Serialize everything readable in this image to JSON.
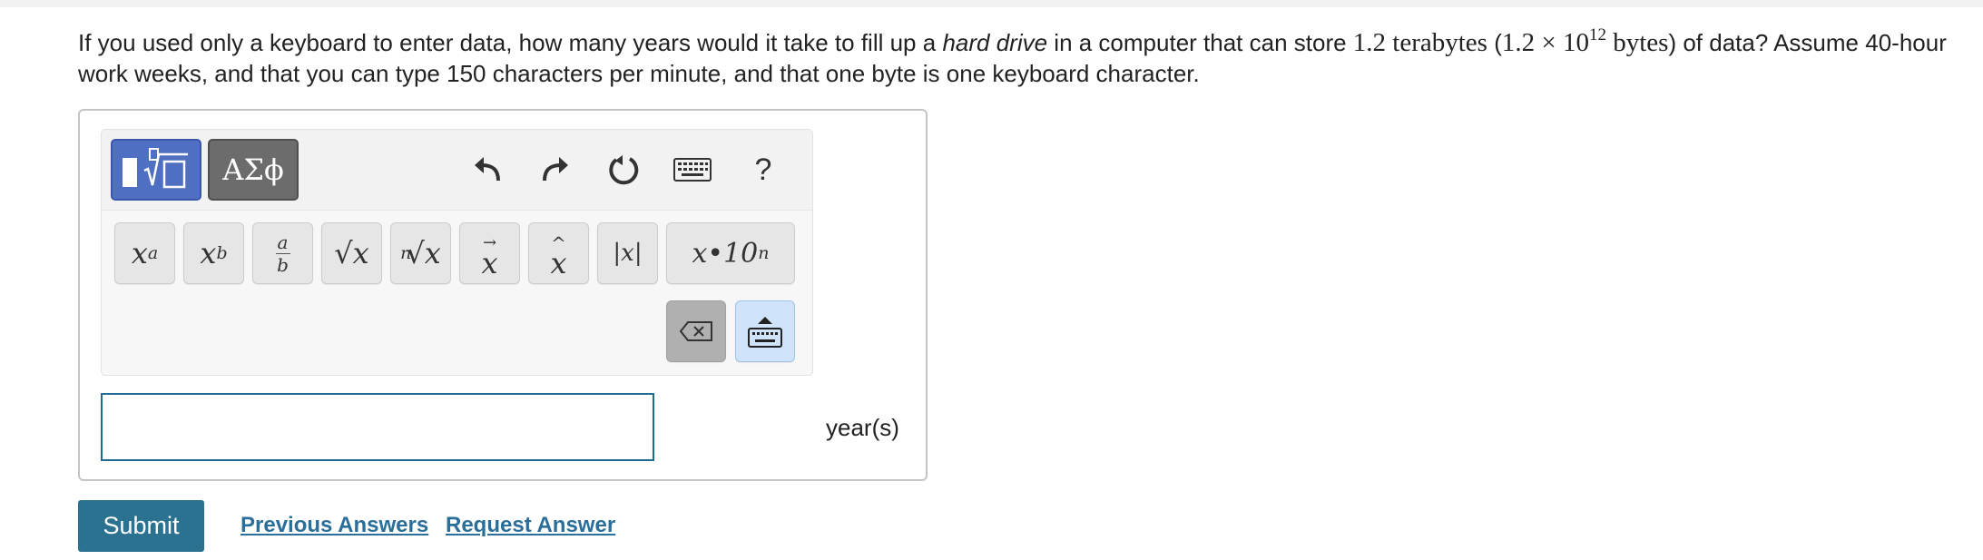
{
  "question": {
    "part1": "If you used only a keyboard to enter data, how many years would it take to fill up a ",
    "emphasis": "hard drive",
    "part2": " in a computer that can store ",
    "capacity": "1.2 terabytes",
    "paren_open": " (",
    "sci_base": "1.2 × 10",
    "sci_exp": "12",
    "sci_unit": " bytes",
    "paren_close": ")",
    "part3": " of data? Assume 40-hour work weeks, and that you can type 150 characters per minute, and that one byte is one keyboard character."
  },
  "toolbar": {
    "greek_label": "ΑΣϕ",
    "help_label": "?",
    "icons": [
      "templates-icon",
      "undo-icon",
      "redo-icon",
      "reset-icon",
      "keyboard-icon",
      "help-icon"
    ]
  },
  "keys": {
    "superscript_base": "x",
    "superscript_exp": "a",
    "subscript_base": "x",
    "subscript_sub": "b",
    "fraction_num": "a",
    "fraction_den": "b",
    "sqrt": "√x",
    "nthroot_index": "n",
    "nthroot": "√x",
    "vector_mark": "→",
    "vector_base": "x",
    "hat_mark": "^",
    "hat_base": "x",
    "abs": "|x|",
    "sci_notation": "x•10",
    "sci_exp": "n"
  },
  "answer": {
    "value": "",
    "unit": "year(s)"
  },
  "actions": {
    "submit": "Submit",
    "previous": "Previous Answers",
    "request": "Request Answer"
  },
  "colors": {
    "accent": "#2b7291",
    "template_blue": "#4f6fc2",
    "link": "#2a6f9a"
  }
}
